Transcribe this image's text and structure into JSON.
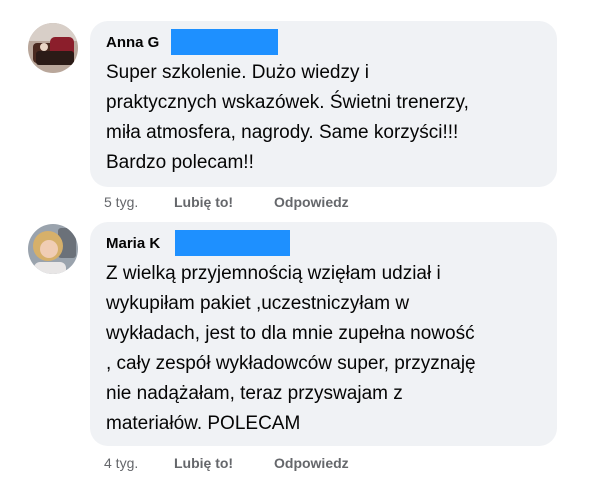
{
  "comments": [
    {
      "author": "Anna G",
      "text": "Super szkolenie. Dużo wiedzy i\npraktycznych wskazówek. Świetni trenerzy,\nmiła atmosfera, nagrody. Same korzyści!!!\nBardzo polecam!!",
      "time": "5 tyg.",
      "like_label": "Lubię to!",
      "reply_label": "Odpowiedz"
    },
    {
      "author": "Maria K",
      "text": "Z wielką przyjemnością wzięłam udział i\nwykupiłam pakiet ,uczestniczyłam w\nwykładach, jest to dla mnie zupełna nowość\n, cały zespół wykładowców super, przyznaję\nnie nadążałam, teraz przyswajam z\nmateriałów. POLECAM",
      "time": "4 tyg.",
      "like_label": "Lubię to!",
      "reply_label": "Odpowiedz"
    }
  ],
  "colors": {
    "bubble_background": "#f0f2f5",
    "redaction": "#1e90ff",
    "meta_text": "#65676b"
  }
}
